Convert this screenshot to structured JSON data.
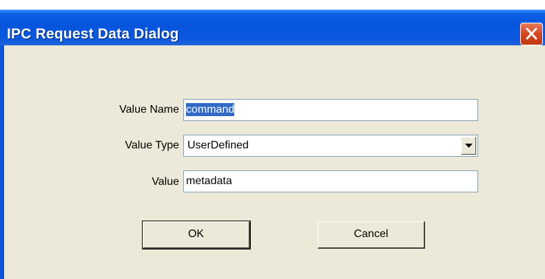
{
  "window": {
    "title": "IPC Request Data Dialog",
    "close_label": "Close"
  },
  "form": {
    "value_name_label": "Value Name",
    "value_name": "command",
    "value_type_label": "Value Type",
    "value_type": "UserDefined",
    "value_label": "Value",
    "value": "metadata"
  },
  "buttons": {
    "ok_label": "OK",
    "cancel_label": "Cancel"
  },
  "icons": {
    "close": "close-x-icon",
    "dropdown": "chevron-down-icon"
  },
  "colors": {
    "titlebar": "#0855DD",
    "dialog_bg": "#ECE9D8",
    "close_button": "#D6461F",
    "selection": "#316AC5"
  }
}
